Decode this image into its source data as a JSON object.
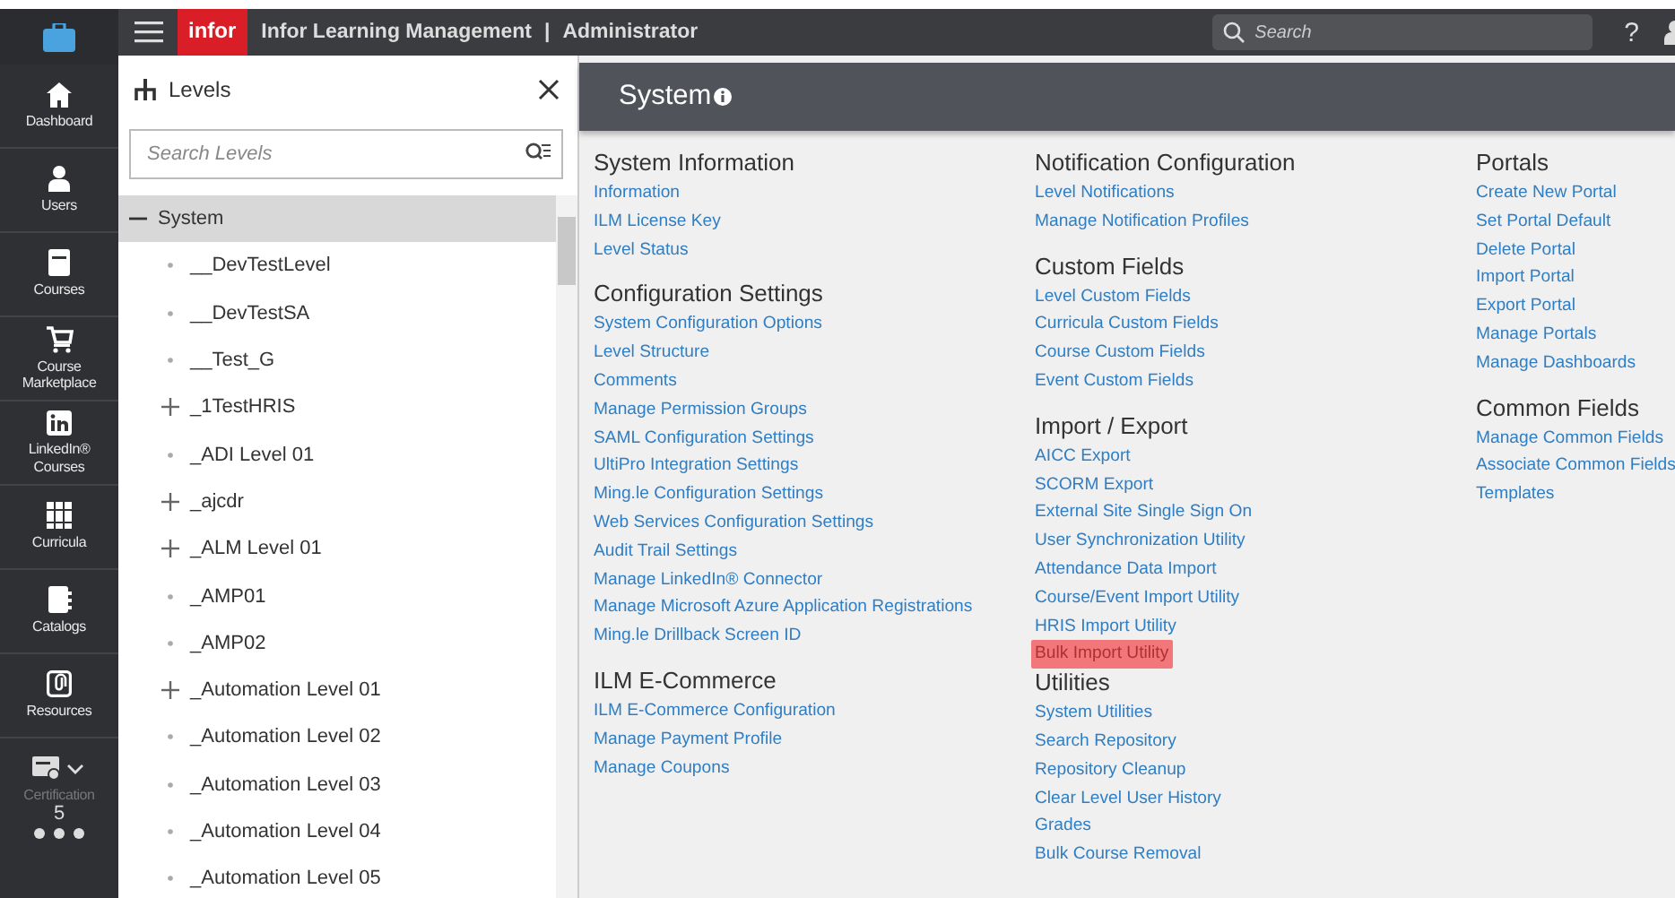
{
  "topbar": {
    "brand": "infor",
    "title": "Infor Learning Management",
    "separator": "|",
    "role": "Administrator",
    "search_placeholder": "Search",
    "help": "?"
  },
  "nav": [
    {
      "label": "Dashboard",
      "kind": "home",
      "disabled": false
    },
    {
      "label": "Users",
      "kind": "user",
      "disabled": false
    },
    {
      "label": "Courses",
      "kind": "course",
      "disabled": false
    },
    {
      "label": "Course Marketplace",
      "kind": "cart",
      "disabled": false
    },
    {
      "label": "LinkedIn® Courses",
      "kind": "linkedin",
      "disabled": false
    },
    {
      "label": "Curricula",
      "kind": "books",
      "disabled": false
    },
    {
      "label": "Catalogs",
      "kind": "catalog",
      "disabled": false
    },
    {
      "label": "Resources",
      "kind": "clip",
      "disabled": false
    },
    {
      "label": "Certification",
      "kind": "cert",
      "disabled": true
    }
  ],
  "nav_count": "5",
  "levels_panel": {
    "title": "Levels",
    "search_placeholder": "Search Levels",
    "items": [
      {
        "label": "System",
        "kind": "expanded",
        "selected": true
      },
      {
        "label": "__DevTestLevel",
        "kind": "leaf",
        "selected": false
      },
      {
        "label": "__DevTestSA",
        "kind": "leaf",
        "selected": false
      },
      {
        "label": "__Test_G",
        "kind": "leaf",
        "selected": false
      },
      {
        "label": "_1TestHRIS",
        "kind": "collapsed",
        "selected": false
      },
      {
        "label": "_ADI Level 01",
        "kind": "leaf",
        "selected": false
      },
      {
        "label": "_ajcdr",
        "kind": "collapsed",
        "selected": false
      },
      {
        "label": "_ALM Level 01",
        "kind": "collapsed",
        "selected": false
      },
      {
        "label": "_AMP01",
        "kind": "leaf",
        "selected": false
      },
      {
        "label": "_AMP02",
        "kind": "leaf",
        "selected": false
      },
      {
        "label": "_Automation Level 01",
        "kind": "collapsed",
        "selected": false
      },
      {
        "label": "_Automation Level 02",
        "kind": "leaf",
        "selected": false
      },
      {
        "label": "_Automation Level 03",
        "kind": "leaf",
        "selected": false
      },
      {
        "label": "_Automation Level 04",
        "kind": "leaf",
        "selected": false
      },
      {
        "label": "_Automation Level 05",
        "kind": "leaf",
        "selected": false
      }
    ]
  },
  "page_title": "System",
  "columns": [
    [
      {
        "heading": "System Information",
        "links": [
          {
            "label": "Information",
            "highlighted": false
          },
          {
            "label": "ILM License Key",
            "highlighted": false
          },
          {
            "label": "Level Status",
            "highlighted": false
          }
        ]
      },
      {
        "heading": "Configuration Settings",
        "links": [
          {
            "label": "System Configuration Options",
            "highlighted": false
          },
          {
            "label": "Level Structure",
            "highlighted": false
          },
          {
            "label": "Comments",
            "highlighted": false
          },
          {
            "label": "Manage Permission Groups",
            "highlighted": false
          },
          {
            "label": "SAML Configuration Settings",
            "highlighted": false
          },
          {
            "label": "UltiPro Integration Settings",
            "highlighted": false
          },
          {
            "label": "Ming.le Configuration Settings",
            "highlighted": false
          },
          {
            "label": "Web Services Configuration Settings",
            "highlighted": false
          },
          {
            "label": "Audit Trail Settings",
            "highlighted": false
          },
          {
            "label": "Manage LinkedIn® Connector",
            "highlighted": false
          },
          {
            "label": "Manage Microsoft Azure Application Registrations",
            "highlighted": false
          },
          {
            "label": "Ming.le Drillback Screen ID",
            "highlighted": false
          }
        ]
      },
      {
        "heading": "ILM E-Commerce",
        "links": [
          {
            "label": "ILM E-Commerce Configuration",
            "highlighted": false
          },
          {
            "label": "Manage Payment Profile",
            "highlighted": false
          },
          {
            "label": "Manage Coupons",
            "highlighted": false
          }
        ]
      }
    ],
    [
      {
        "heading": "Notification Configuration",
        "links": [
          {
            "label": "Level Notifications",
            "highlighted": false
          },
          {
            "label": "Manage Notification Profiles",
            "highlighted": false
          }
        ]
      },
      {
        "heading": "Custom Fields",
        "links": [
          {
            "label": "Level Custom Fields",
            "highlighted": false
          },
          {
            "label": "Curricula Custom Fields",
            "highlighted": false
          },
          {
            "label": "Course Custom Fields",
            "highlighted": false
          },
          {
            "label": "Event Custom Fields",
            "highlighted": false
          }
        ]
      },
      {
        "heading": "Import / Export",
        "links": [
          {
            "label": "AICC Export",
            "highlighted": false
          },
          {
            "label": "SCORM Export",
            "highlighted": false
          },
          {
            "label": "External Site Single Sign On",
            "highlighted": false
          },
          {
            "label": "User Synchronization Utility",
            "highlighted": false
          },
          {
            "label": "Attendance Data Import",
            "highlighted": false
          },
          {
            "label": "Course/Event Import Utility",
            "highlighted": false
          },
          {
            "label": "HRIS Import Utility",
            "highlighted": false
          },
          {
            "label": "Bulk Import Utility",
            "highlighted": true
          }
        ]
      },
      {
        "heading": "Utilities",
        "links": [
          {
            "label": "System Utilities",
            "highlighted": false
          },
          {
            "label": "Search Repository",
            "highlighted": false
          },
          {
            "label": "Repository Cleanup",
            "highlighted": false
          },
          {
            "label": "Clear Level User History",
            "highlighted": false
          },
          {
            "label": "Grades",
            "highlighted": false
          },
          {
            "label": "Bulk Course Removal",
            "highlighted": false
          }
        ]
      }
    ],
    [
      {
        "heading": "Portals",
        "links": [
          {
            "label": "Create New Portal",
            "highlighted": false
          },
          {
            "label": "Set Portal Default",
            "highlighted": false
          },
          {
            "label": "Delete Portal",
            "highlighted": false
          },
          {
            "label": "Import Portal",
            "highlighted": false
          },
          {
            "label": "Export Portal",
            "highlighted": false
          },
          {
            "label": "Manage Portals",
            "highlighted": false
          },
          {
            "label": "Manage Dashboards",
            "highlighted": false
          }
        ]
      },
      {
        "heading": "Common Fields",
        "links": [
          {
            "label": "Manage Common Fields",
            "highlighted": false
          },
          {
            "label": "Associate Common Fields",
            "highlighted": false
          },
          {
            "label": "Templates",
            "highlighted": false
          }
        ]
      }
    ]
  ]
}
